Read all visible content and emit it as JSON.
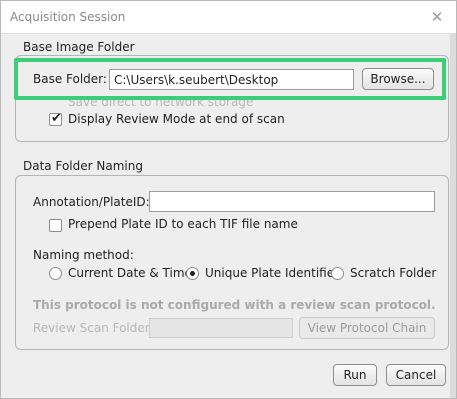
{
  "window": {
    "title": "Acquisition Session",
    "close_icon": "close-icon"
  },
  "base_section": {
    "title": "Base Image Folder",
    "base_folder_label": "Base Folder:",
    "base_folder_value": "C:\\Users\\k.seubert\\Desktop",
    "browse_label": "Browse...",
    "hidden_option_label": "Save direct to network storage",
    "display_review_label": "Display Review Mode at end of scan",
    "display_review_checked": true
  },
  "data_section": {
    "title": "Data Folder Naming",
    "annotation_label": "Annotation/PlateID:",
    "annotation_value": "",
    "prepend_label": "Prepend Plate ID to each TIF file name",
    "prepend_checked": false,
    "naming_method_label": "Naming method:",
    "naming_options": [
      {
        "label": "Current Date & Time",
        "selected": false
      },
      {
        "label": "Unique Plate Identifier",
        "selected": true
      },
      {
        "label": "Scratch Folder",
        "selected": false
      }
    ],
    "warning_text": "This protocol is not configured with a review scan protocol.",
    "review_folder_label": "Review Scan Folder:",
    "view_protocol_label": "View Protocol Chain"
  },
  "footer": {
    "run_label": "Run",
    "cancel_label": "Cancel"
  },
  "colors": {
    "highlight": "#3ccd78",
    "dialog_background": "#eeeeee"
  }
}
